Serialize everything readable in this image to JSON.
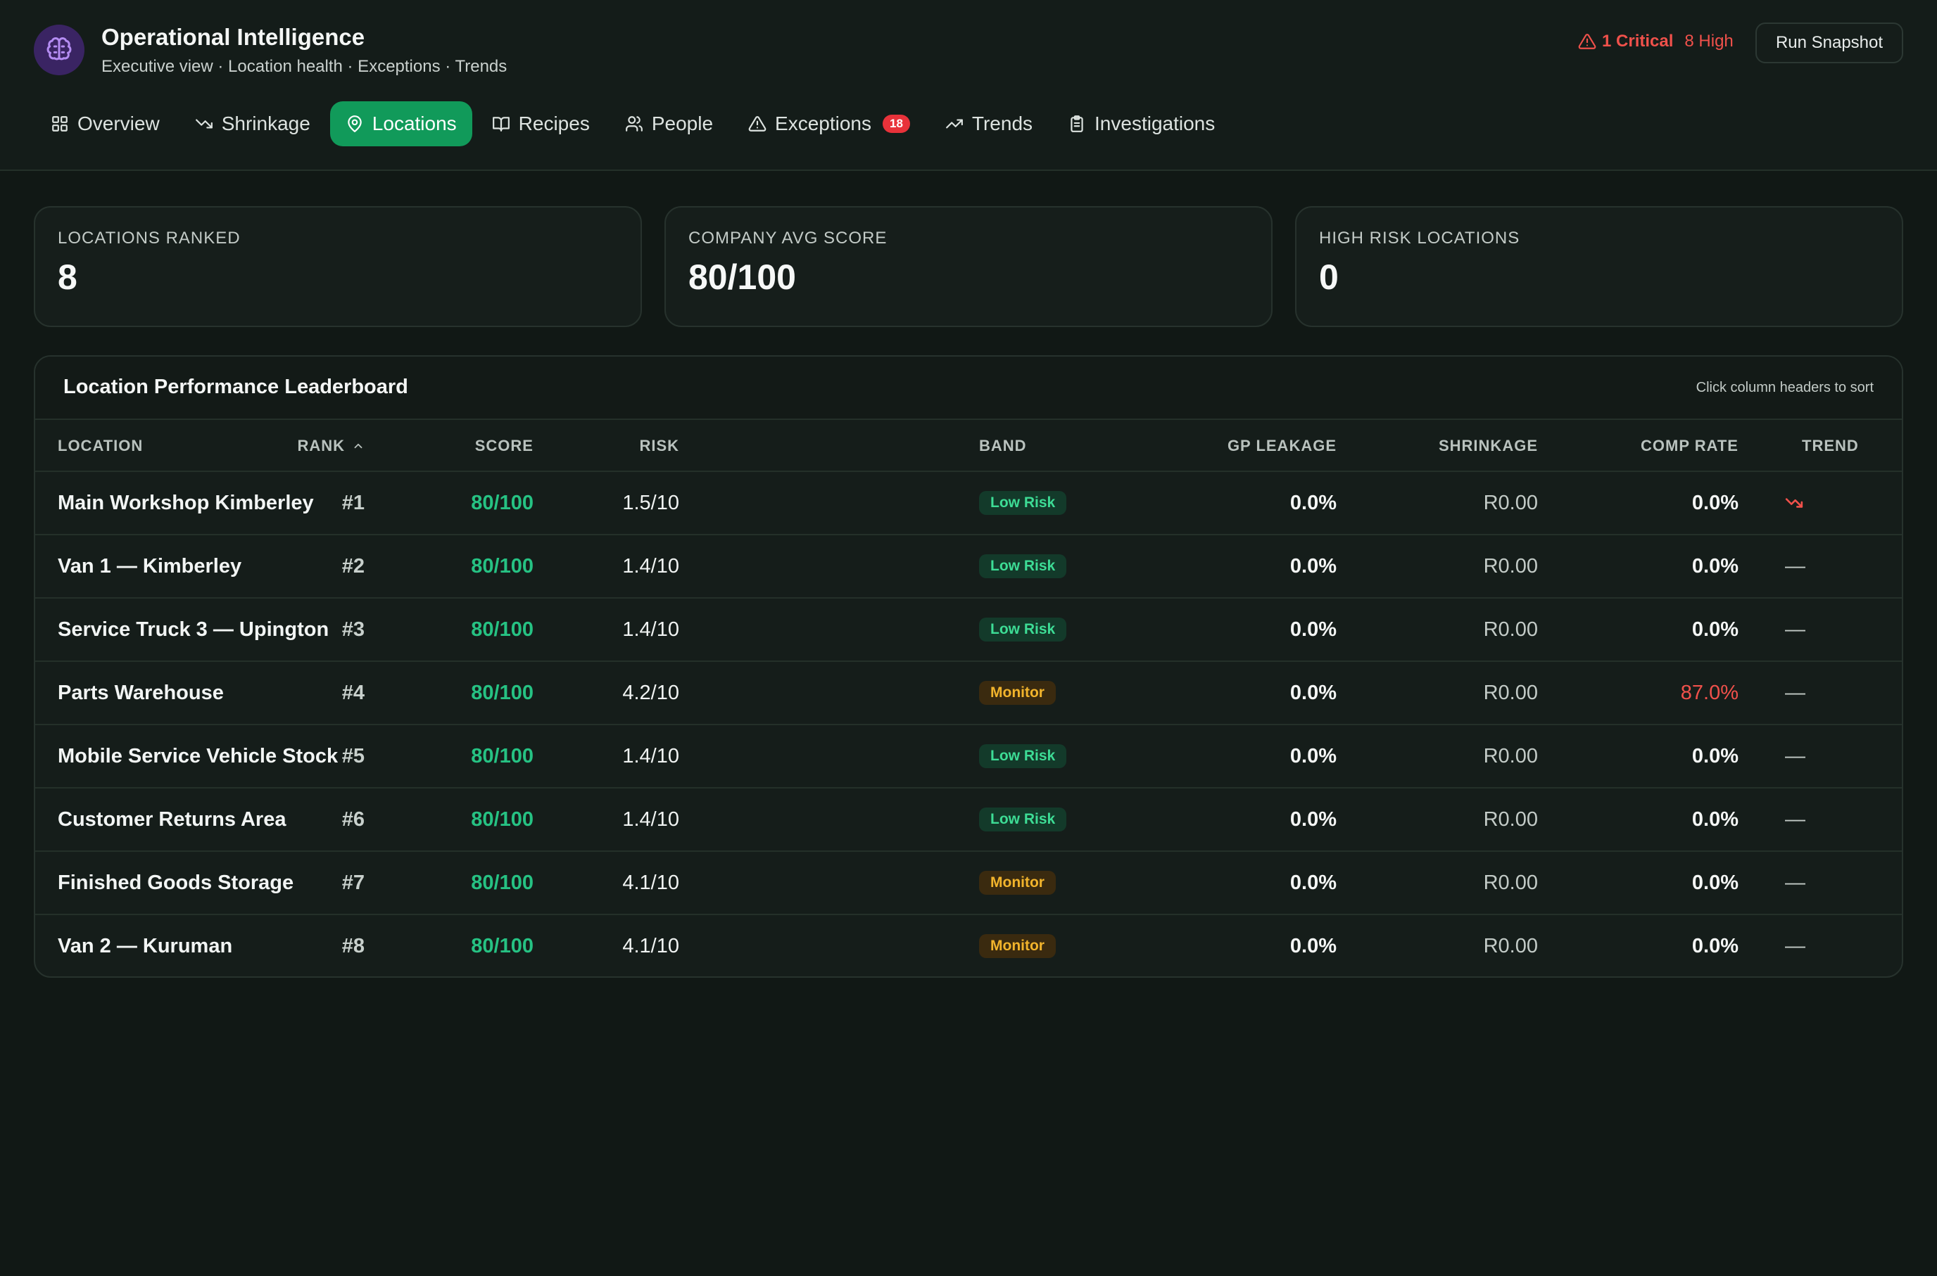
{
  "app": {
    "title": "Operational Intelligence",
    "subtitle": "Executive view · Location health · Exceptions · Trends",
    "logo_icon": "brain-icon",
    "accent": "#119a5a"
  },
  "alerts": {
    "critical": "1 Critical",
    "high": "8 High",
    "color": "#f0514b"
  },
  "actions": {
    "snapshot": "Run Snapshot"
  },
  "tabs": [
    {
      "label": "Overview",
      "icon": "grid-icon",
      "active": false
    },
    {
      "label": "Shrinkage",
      "icon": "trending-down-icon",
      "active": false
    },
    {
      "label": "Locations",
      "icon": "map-pin-icon",
      "active": true
    },
    {
      "label": "Recipes",
      "icon": "book-icon",
      "active": false
    },
    {
      "label": "People",
      "icon": "users-icon",
      "active": false
    },
    {
      "label": "Exceptions",
      "icon": "warning-icon",
      "active": false,
      "badge": "18"
    },
    {
      "label": "Trends",
      "icon": "trending-up-icon",
      "active": false
    },
    {
      "label": "Investigations",
      "icon": "clipboard-icon",
      "active": false
    }
  ],
  "kpis": [
    {
      "label": "LOCATIONS RANKED",
      "value": "8"
    },
    {
      "label": "COMPANY AVG SCORE",
      "value": "80/100"
    },
    {
      "label": "HIGH RISK LOCATIONS",
      "value": "0"
    }
  ],
  "leaderboard": {
    "title": "Location Performance Leaderboard",
    "hint": "Click column headers to sort",
    "columns": {
      "location": "LOCATION",
      "rank": "RANK",
      "score": "SCORE",
      "risk": "RISK",
      "band": "BAND",
      "gp_leakage": "GP LEAKAGE",
      "shrinkage": "SHRINKAGE",
      "comp_rate": "COMP RATE",
      "trend": "TREND"
    },
    "rows": [
      {
        "location": "Main Workshop Kimberley",
        "rank": "#1",
        "score": "80/100",
        "risk": "1.5/10",
        "band": "Low Risk",
        "gp_leakage": "0.0%",
        "shrinkage": "R0.00",
        "comp_rate": "0.0%",
        "trend": "down"
      },
      {
        "location": "Van 1 — Kimberley",
        "rank": "#2",
        "score": "80/100",
        "risk": "1.4/10",
        "band": "Low Risk",
        "gp_leakage": "0.0%",
        "shrinkage": "R0.00",
        "comp_rate": "0.0%",
        "trend": "—"
      },
      {
        "location": "Service Truck 3 — Upington",
        "rank": "#3",
        "score": "80/100",
        "risk": "1.4/10",
        "band": "Low Risk",
        "gp_leakage": "0.0%",
        "shrinkage": "R0.00",
        "comp_rate": "0.0%",
        "trend": "—"
      },
      {
        "location": "Parts Warehouse",
        "rank": "#4",
        "score": "80/100",
        "risk": "4.2/10",
        "band": "Monitor",
        "gp_leakage": "0.0%",
        "shrinkage": "R0.00",
        "comp_rate": "87.0%",
        "trend": "—"
      },
      {
        "location": "Mobile Service Vehicle Stock",
        "rank": "#5",
        "score": "80/100",
        "risk": "1.4/10",
        "band": "Low Risk",
        "gp_leakage": "0.0%",
        "shrinkage": "R0.00",
        "comp_rate": "0.0%",
        "trend": "—"
      },
      {
        "location": "Customer Returns Area",
        "rank": "#6",
        "score": "80/100",
        "risk": "1.4/10",
        "band": "Low Risk",
        "gp_leakage": "0.0%",
        "shrinkage": "R0.00",
        "comp_rate": "0.0%",
        "trend": "—"
      },
      {
        "location": "Finished Goods Storage",
        "rank": "#7",
        "score": "80/100",
        "risk": "4.1/10",
        "band": "Monitor",
        "gp_leakage": "0.0%",
        "shrinkage": "R0.00",
        "comp_rate": "0.0%",
        "trend": "—"
      },
      {
        "location": "Van 2 — Kuruman",
        "rank": "#8",
        "score": "80/100",
        "risk": "4.1/10",
        "band": "Monitor",
        "gp_leakage": "0.0%",
        "shrinkage": "R0.00",
        "comp_rate": "0.0%",
        "trend": "—"
      }
    ]
  }
}
